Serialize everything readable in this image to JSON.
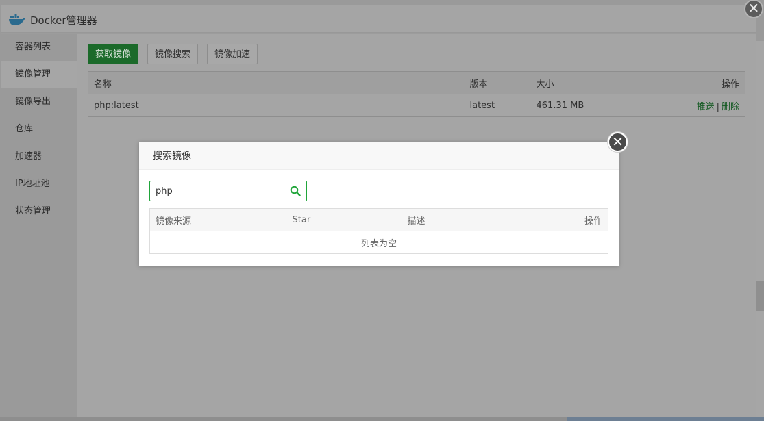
{
  "window": {
    "title": "Docker管理器",
    "close_glyph": "✕"
  },
  "sidebar": {
    "items": [
      {
        "label": "容器列表"
      },
      {
        "label": "镜像管理"
      },
      {
        "label": "镜像导出"
      },
      {
        "label": "仓库"
      },
      {
        "label": "加速器"
      },
      {
        "label": "IP地址池"
      },
      {
        "label": "状态管理"
      }
    ],
    "active_index": 1
  },
  "toolbar": {
    "pull_label": "获取镜像",
    "search_label": "镜像搜索",
    "accelerate_label": "镜像加速"
  },
  "image_table": {
    "headers": {
      "name": "名称",
      "version": "版本",
      "size": "大小",
      "ops": "操作"
    },
    "rows": [
      {
        "name": "php:latest",
        "version": "latest",
        "size": "461.31 MB",
        "push": "推送",
        "sep": "|",
        "delete": "删除"
      }
    ]
  },
  "search_modal": {
    "title": "搜索镜像",
    "close_glyph": "✕",
    "query": "php",
    "headers": {
      "source": "镜像来源",
      "star": "Star",
      "desc": "描述",
      "ops": "操作"
    },
    "empty_text": "列表为空"
  },
  "colors": {
    "accent_green": "#20a53a",
    "overlay": "#9c9c9c"
  }
}
